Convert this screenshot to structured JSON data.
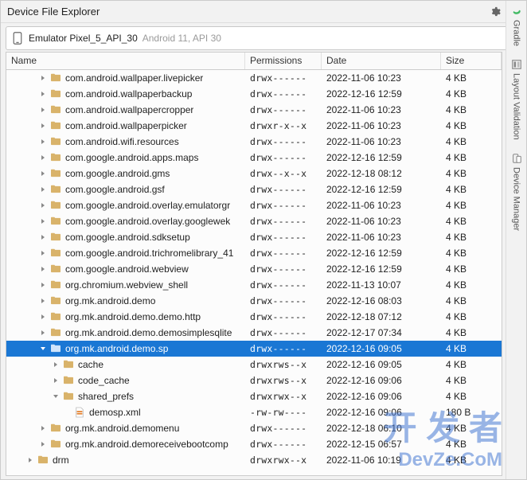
{
  "header": {
    "title": "Device File Explorer"
  },
  "device": {
    "label": "Emulator Pixel_5_API_30",
    "sub": "Android 11, API 30"
  },
  "columns": {
    "c0": "Name",
    "c1": "Permissions",
    "c2": "Date",
    "c3": "Size"
  },
  "rows": [
    {
      "depth": 2,
      "arrow": "r",
      "icon": "folder",
      "name": "com.android.wallpaper.livepicker",
      "perm": "drwx------",
      "date": "2022-11-06 10:23",
      "size": "4 KB",
      "sel": false
    },
    {
      "depth": 2,
      "arrow": "r",
      "icon": "folder",
      "name": "com.android.wallpaperbackup",
      "perm": "drwx------",
      "date": "2022-12-16 12:59",
      "size": "4 KB",
      "sel": false
    },
    {
      "depth": 2,
      "arrow": "r",
      "icon": "folder",
      "name": "com.android.wallpapercropper",
      "perm": "drwx------",
      "date": "2022-11-06 10:23",
      "size": "4 KB",
      "sel": false
    },
    {
      "depth": 2,
      "arrow": "r",
      "icon": "folder",
      "name": "com.android.wallpaperpicker",
      "perm": "drwxr-x--x",
      "date": "2022-11-06 10:23",
      "size": "4 KB",
      "sel": false
    },
    {
      "depth": 2,
      "arrow": "r",
      "icon": "folder",
      "name": "com.android.wifi.resources",
      "perm": "drwx------",
      "date": "2022-11-06 10:23",
      "size": "4 KB",
      "sel": false
    },
    {
      "depth": 2,
      "arrow": "r",
      "icon": "folder",
      "name": "com.google.android.apps.maps",
      "perm": "drwx------",
      "date": "2022-12-16 12:59",
      "size": "4 KB",
      "sel": false
    },
    {
      "depth": 2,
      "arrow": "r",
      "icon": "folder",
      "name": "com.google.android.gms",
      "perm": "drwx--x--x",
      "date": "2022-12-18 08:12",
      "size": "4 KB",
      "sel": false
    },
    {
      "depth": 2,
      "arrow": "r",
      "icon": "folder",
      "name": "com.google.android.gsf",
      "perm": "drwx------",
      "date": "2022-12-16 12:59",
      "size": "4 KB",
      "sel": false
    },
    {
      "depth": 2,
      "arrow": "r",
      "icon": "folder",
      "name": "com.google.android.overlay.emulatorgr",
      "perm": "drwx------",
      "date": "2022-11-06 10:23",
      "size": "4 KB",
      "sel": false
    },
    {
      "depth": 2,
      "arrow": "r",
      "icon": "folder",
      "name": "com.google.android.overlay.googlewek",
      "perm": "drwx------",
      "date": "2022-11-06 10:23",
      "size": "4 KB",
      "sel": false
    },
    {
      "depth": 2,
      "arrow": "r",
      "icon": "folder",
      "name": "com.google.android.sdksetup",
      "perm": "drwx------",
      "date": "2022-11-06 10:23",
      "size": "4 KB",
      "sel": false
    },
    {
      "depth": 2,
      "arrow": "r",
      "icon": "folder",
      "name": "com.google.android.trichromelibrary_41",
      "perm": "drwx------",
      "date": "2022-12-16 12:59",
      "size": "4 KB",
      "sel": false
    },
    {
      "depth": 2,
      "arrow": "r",
      "icon": "folder",
      "name": "com.google.android.webview",
      "perm": "drwx------",
      "date": "2022-12-16 12:59",
      "size": "4 KB",
      "sel": false
    },
    {
      "depth": 2,
      "arrow": "r",
      "icon": "folder",
      "name": "org.chromium.webview_shell",
      "perm": "drwx------",
      "date": "2022-11-13 10:07",
      "size": "4 KB",
      "sel": false
    },
    {
      "depth": 2,
      "arrow": "r",
      "icon": "folder",
      "name": "org.mk.android.demo",
      "perm": "drwx------",
      "date": "2022-12-16 08:03",
      "size": "4 KB",
      "sel": false
    },
    {
      "depth": 2,
      "arrow": "r",
      "icon": "folder",
      "name": "org.mk.android.demo.demo.http",
      "perm": "drwx------",
      "date": "2022-12-18 07:12",
      "size": "4 KB",
      "sel": false
    },
    {
      "depth": 2,
      "arrow": "r",
      "icon": "folder",
      "name": "org.mk.android.demo.demosimplesqlite",
      "perm": "drwx------",
      "date": "2022-12-17 07:34",
      "size": "4 KB",
      "sel": false
    },
    {
      "depth": 2,
      "arrow": "d",
      "icon": "folder",
      "name": "org.mk.android.demo.sp",
      "perm": "drwx------",
      "date": "2022-12-16 09:05",
      "size": "4 KB",
      "sel": true
    },
    {
      "depth": 3,
      "arrow": "r",
      "icon": "folder",
      "name": "cache",
      "perm": "drwxrws--x",
      "date": "2022-12-16 09:05",
      "size": "4 KB",
      "sel": false
    },
    {
      "depth": 3,
      "arrow": "r",
      "icon": "folder",
      "name": "code_cache",
      "perm": "drwxrws--x",
      "date": "2022-12-16 09:06",
      "size": "4 KB",
      "sel": false
    },
    {
      "depth": 3,
      "arrow": "d",
      "icon": "folder",
      "name": "shared_prefs",
      "perm": "drwxrwx--x",
      "date": "2022-12-16 09:06",
      "size": "4 KB",
      "sel": false
    },
    {
      "depth": 4,
      "arrow": "",
      "icon": "file",
      "name": "demosp.xml",
      "perm": "-rw-rw----",
      "date": "2022-12-16 09:06",
      "size": "180 B",
      "sel": false
    },
    {
      "depth": 2,
      "arrow": "r",
      "icon": "folder",
      "name": "org.mk.android.demomenu",
      "perm": "drwx------",
      "date": "2022-12-18 06:10",
      "size": "4 KB",
      "sel": false
    },
    {
      "depth": 2,
      "arrow": "r",
      "icon": "folder",
      "name": "org.mk.android.demoreceivebootcomp",
      "perm": "drwx------",
      "date": "2022-12-15 06:57",
      "size": "4 KB",
      "sel": false
    },
    {
      "depth": 1,
      "arrow": "r",
      "icon": "folder",
      "name": "drm",
      "perm": "drwxrwx--x",
      "date": "2022-11-06 10:19",
      "size": "4 KB",
      "sel": false
    }
  ],
  "rtabs": [
    {
      "id": "gradle",
      "label": "Gradle"
    },
    {
      "id": "layout",
      "label": "Layout Validation"
    },
    {
      "id": "device",
      "label": "Device Manager"
    }
  ],
  "watermark": {
    "l1": "开 发 者",
    "l2": "DevZe.CoM"
  }
}
